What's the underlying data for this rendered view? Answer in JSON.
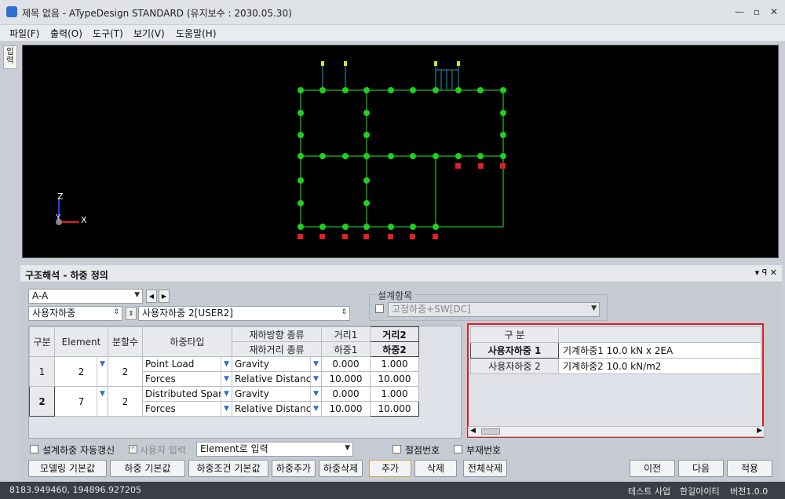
{
  "window": {
    "title": "제목 없음 - ATypeDesign STANDARD (유지보수 : 2030.05.30)",
    "minimize": "—",
    "restore": "▫",
    "close": "✕"
  },
  "menu": [
    "파일(F)",
    "출력(O)",
    "도구(T)",
    "보기(V)",
    "도움말(H)"
  ],
  "side_tab": "입력",
  "axis": {
    "z": "Z",
    "y": "Y",
    "x": "X"
  },
  "panel": {
    "title": "구조해석 - 하중 정의",
    "pin": "▾ ꟼ ✕"
  },
  "selectors": {
    "member": "A-A",
    "case_type": "사용자하중",
    "case_name": "사용자하중 2[USER2]"
  },
  "design_group": {
    "label": "설계항목",
    "option": "고정하중+SW[DC]"
  },
  "grid": {
    "headers": {
      "col_gubun": "구분",
      "col_element": "Element",
      "col_div": "분할수",
      "col_type": "하중타입",
      "col_dir": "재하방향 종류",
      "col_dist": "재하거리 종류",
      "col_d1": "거리1",
      "col_d2": "거리2",
      "col_l1": "하중1",
      "col_l2": "하중2"
    },
    "rows": [
      {
        "no": "1",
        "element": "2",
        "div": "2",
        "type_a": "Point Load",
        "type_b": "Forces",
        "dir": "Gravity",
        "dist": "Relative Distance",
        "d1": "0.000",
        "d2": "1.000",
        "l1": "10.000",
        "l2": "10.000"
      },
      {
        "no": "2",
        "element": "7",
        "div": "2",
        "type_a": "Distributed Span",
        "type_b": "Forces",
        "dir": "Gravity",
        "dist": "Relative Distance",
        "d1": "0.000",
        "d2": "1.000",
        "l1": "10.000",
        "l2": "10.000"
      }
    ]
  },
  "summary": {
    "header": "구 분",
    "rows": [
      {
        "name": "사용자하중 1",
        "desc": "기계하중1 10.0 kN x 2EA"
      },
      {
        "name": "사용자하중 2",
        "desc": "기계하중2 10.0 kN/m2"
      }
    ]
  },
  "options": {
    "auto_update": "설계하중 자동갱신",
    "user_input": "사용자 입력",
    "input_mode": "Element로 입력",
    "node_no": "절점번호",
    "member_no": "부재번호"
  },
  "buttons": {
    "modeling_default": "모델링 기본값",
    "load_default": "하중 기본값",
    "cond_default": "하중조건 기본값",
    "add_load": "하중추가",
    "del_load": "하중삭제",
    "add": "추가",
    "delete": "삭제",
    "delete_all": "전체삭제",
    "prev": "이전",
    "next": "다음",
    "apply": "적용"
  },
  "status": {
    "coords": "8183.949460,  194896.927205",
    "s1": "테스트 사업",
    "s2": "한길아이티",
    "s3": "버전1.0.0"
  }
}
